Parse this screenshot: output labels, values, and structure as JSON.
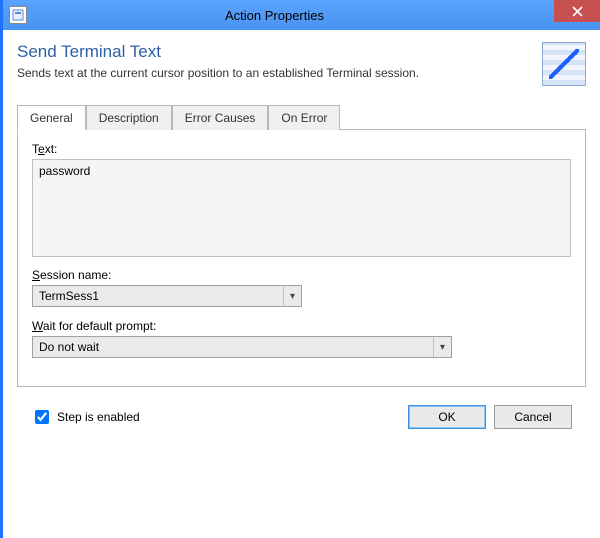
{
  "window": {
    "title": "Action Properties"
  },
  "header": {
    "heading": "Send Terminal Text",
    "subheading": "Sends text at the current cursor position to an established Terminal session."
  },
  "tabs": {
    "items": [
      {
        "label": "General"
      },
      {
        "label": "Description"
      },
      {
        "label": "Error Causes"
      },
      {
        "label": "On Error"
      }
    ]
  },
  "fields": {
    "text": {
      "label_pre": "T",
      "label_ul": "e",
      "label_post": "xt:",
      "value": "password"
    },
    "session": {
      "label_pre": "",
      "label_ul": "S",
      "label_post": "ession name:",
      "value": "TermSess1"
    },
    "wait": {
      "label_pre": "",
      "label_ul": "W",
      "label_post": "ait for default prompt:",
      "value": "Do not wait"
    }
  },
  "footer": {
    "step_enabled_label": "Step is enabled",
    "step_enabled_checked": true,
    "ok": "OK",
    "cancel": "Cancel"
  }
}
